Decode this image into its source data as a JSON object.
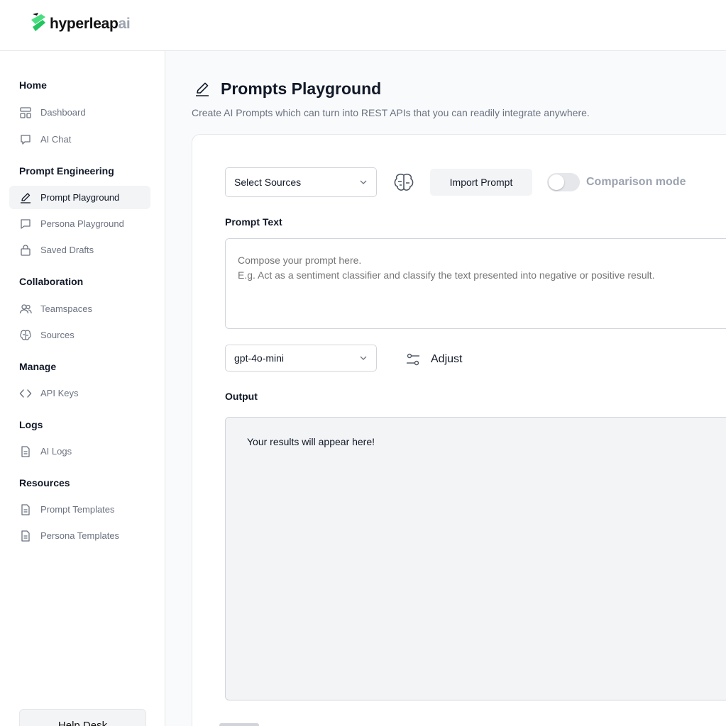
{
  "brand": {
    "name": "hyperleap",
    "suffix": "ai",
    "logo_color": "#4ade80"
  },
  "sidebar": {
    "sections": [
      {
        "title": "Home",
        "items": [
          {
            "label": "Dashboard",
            "icon": "dashboard-icon"
          },
          {
            "label": "AI Chat",
            "icon": "chat-icon"
          }
        ]
      },
      {
        "title": "Prompt Engineering",
        "items": [
          {
            "label": "Prompt Playground",
            "icon": "pencil-icon",
            "active": true
          },
          {
            "label": "Persona Playground",
            "icon": "message-square-icon"
          },
          {
            "label": "Saved Drafts",
            "icon": "bag-icon"
          }
        ]
      },
      {
        "title": "Collaboration",
        "items": [
          {
            "label": "Teamspaces",
            "icon": "users-icon"
          },
          {
            "label": "Sources",
            "icon": "brain-icon"
          }
        ]
      },
      {
        "title": "Manage",
        "items": [
          {
            "label": "API Keys",
            "icon": "code-icon"
          }
        ]
      },
      {
        "title": "Logs",
        "items": [
          {
            "label": "AI Logs",
            "icon": "document-icon"
          }
        ]
      },
      {
        "title": "Resources",
        "items": [
          {
            "label": "Prompt Templates",
            "icon": "document-icon"
          },
          {
            "label": "Persona Templates",
            "icon": "document-icon"
          }
        ]
      }
    ],
    "help_label": "Help Desk"
  },
  "main": {
    "title": "Prompts Playground",
    "subtitle": "Create AI Prompts which can turn into REST APIs that you can readily integrate anywhere.",
    "sources_select": "Select Sources",
    "import_label": "Import Prompt",
    "comparison_label": "Comparison mode",
    "comparison_on": false,
    "prompt_label": "Prompt Text",
    "prompt_placeholder": "Compose your prompt here.\nE.g. Act as a sentiment classifier and classify the text presented into negative or positive result.",
    "model_select": "gpt-4o-mini",
    "adjust_label": "Adjust",
    "output_label": "Output",
    "output_text": "Your results will appear here!"
  }
}
